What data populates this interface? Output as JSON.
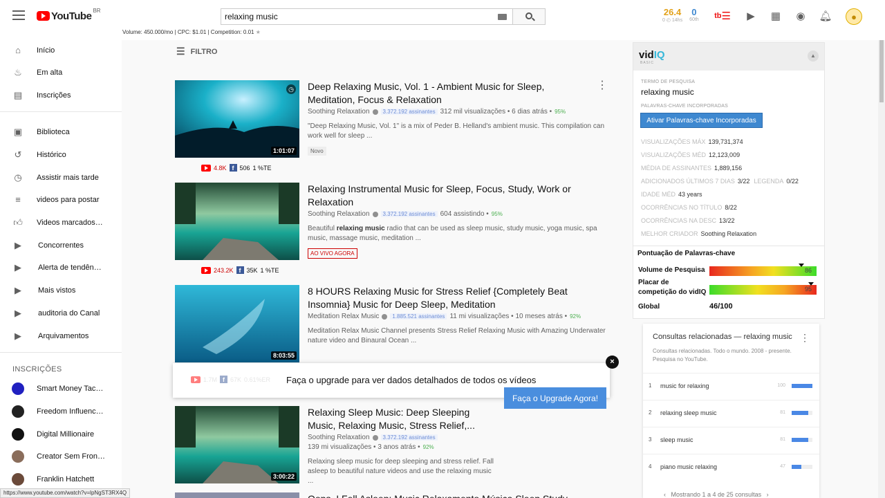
{
  "header": {
    "logo_text": "YouTube",
    "logo_region": "BR",
    "search_value": "relaxing music",
    "keyword_stats": "Volume: 450.000/mo | CPC: $1.01 | Competition: 0.01",
    "score1": {
      "value": "26.4",
      "sub": "0 ◴ 14hs"
    },
    "score2": {
      "value": "0",
      "sub": "60th"
    }
  },
  "sidebar": {
    "main": [
      {
        "label": "Início",
        "icon": "home-icon"
      },
      {
        "label": "Em alta",
        "icon": "fire-icon"
      },
      {
        "label": "Inscrições",
        "icon": "subscriptions-icon"
      }
    ],
    "library": [
      {
        "label": "Biblioteca",
        "icon": "folder-icon"
      },
      {
        "label": "Histórico",
        "icon": "history-icon"
      },
      {
        "label": "Assistir mais tarde",
        "icon": "clock-icon"
      },
      {
        "label": "videos para postar",
        "icon": "playlist-icon"
      },
      {
        "label": "Videos marcados…",
        "icon": "thumb-up-icon"
      },
      {
        "label": "Concorrentes",
        "icon": "playlist-play-icon"
      },
      {
        "label": "Alerta de tendên…",
        "icon": "playlist-play-icon"
      },
      {
        "label": "Mais vistos",
        "icon": "playlist-play-icon"
      },
      {
        "label": "auditoria do Canal",
        "icon": "playlist-play-icon"
      },
      {
        "label": "Arquivamentos",
        "icon": "playlist-play-icon"
      }
    ],
    "subs_header": "INSCRIÇÕES",
    "subscriptions": [
      {
        "label": "Smart Money Tac…",
        "color": "#2020c0"
      },
      {
        "label": "Freedom Influenc…",
        "color": "#222222"
      },
      {
        "label": "Digital Millionaire",
        "color": "#111111"
      },
      {
        "label": "Creator Sem Fron…",
        "color": "#8a6d5b"
      },
      {
        "label": "Franklin Hatchett",
        "color": "#6b4a3a"
      }
    ]
  },
  "status_url": "https://www.youtube.com/watch?v=lpNgST3RX4Q",
  "filter_label": "FILTRO",
  "videos": [
    {
      "title": "Deep Relaxing Music, Vol. 1 - Ambient Music for Sleep, Meditation, Focus & Relaxation",
      "channel": "Soothing Relaxation",
      "subs": "3.372.192 assinantes",
      "meta": "312 mil visualizações • 6 dias atrás •",
      "pct": "95%",
      "desc": "\"Deep Relaxing Music, Vol. 1\" is a mix of Peder B. Helland's ambient music. This compilation can work well for sleep ...",
      "badge": "Novo",
      "duration": "1:01:07",
      "yt": "4.8K",
      "fb": "506",
      "te": "1 %TE"
    },
    {
      "title": "Relaxing Instrumental Music for Sleep, Focus, Study, Work or Relaxation",
      "channel": "Soothing Relaxation",
      "subs": "3.372.192 assinantes",
      "meta": "604 assistindo •",
      "pct": "95%",
      "desc_pre": "Beautiful ",
      "desc_bold": "relaxing music",
      "desc_post": " radio that can be used as sleep music, study music, yoga music, spa music, massage music, meditation ...",
      "badge": "AO VIVO AGORA",
      "yt": "243.2K",
      "fb": "35K",
      "te": "1 %TE"
    },
    {
      "title": "8 HOURS Relaxing Music for Stress Relief {Completely Beat Insomnia} Music for Deep Sleep, Meditation",
      "channel": "Meditation Relax Music",
      "subs": "1.885.521 assinantes",
      "meta": "11 mi visualizações • 10 meses atrás •",
      "pct": "92%",
      "desc": "Meditation Relax Music Channel presents Stress Relief Relaxing Music with Amazing Underwater nature video and Binaural Ocean ...",
      "duration": "8:03:55"
    },
    {
      "title": "Relaxing Sleep Music: Deep Sleeping Music, Relaxing Music, Stress Relief,...",
      "channel": "Soothing Relaxation",
      "subs": "3.372.192 assinantes",
      "meta": "139 mi visualizações • 3 anos atrás •",
      "pct": "92%",
      "desc": "Relaxing sleep music for deep sleeping and stress relief. Fall asleep to beautiful nature videos and use the relaxing music ...",
      "duration": "3:00:22"
    },
    {
      "title": "Oops, I Fell Asleep: Music Relaxamento Música Sleep Study Meditative"
    }
  ],
  "upgrade": {
    "faded_yt": "1.7M",
    "faded_fb": "67K",
    "faded_er": "0.61%ER",
    "message": "Faça o upgrade para ver dados detalhados de todos os vídeos",
    "button": "Faça o Upgrade Agora!",
    "close": "×"
  },
  "vidiq": {
    "logo_a": "vid",
    "logo_b": "IQ",
    "logo_sub": "BASIC",
    "term_label": "TERMO DE PESQUISA",
    "term": "relaxing music",
    "embedded_label": "PALAVRAS-CHAVE INCORPORADAS",
    "embedded_button": "Ativar Palavras-chave Incorporadas",
    "rows": [
      {
        "label": "VISUALIZAÇÕES MÁX",
        "value": "139,731,374"
      },
      {
        "label": "VISUALIZAÇÕES MÉD",
        "value": "12,123,009"
      },
      {
        "label": "MÉDIA DE ASSINANTES",
        "value": "1,889,156"
      },
      {
        "label": "ADICIONADOS ÚLTIMOS 7 DIAS",
        "value": "3/22",
        "extra_label": "LEGENDA",
        "extra_value": "0/22"
      },
      {
        "label": "IDADE MÉD",
        "value": "43 years"
      },
      {
        "label": "OCORRÊNCIAS NO TÍTULO",
        "value": "8/22"
      },
      {
        "label": "OCORRÊNCIAS NA DESC",
        "value": "13/22"
      },
      {
        "label": "MELHOR CRIADOR",
        "value": "Soothing Relaxation"
      }
    ],
    "score_title": "Pontuação de Palavras-chave",
    "volume_label": "Volume de Pesquisa",
    "volume_value": "86",
    "competition_label": "Placar de competição do vidIQ",
    "competition_value": "95",
    "global_label": "Global",
    "global_value": "46/100"
  },
  "related": {
    "title": "Consultas relacionadas — relaxing music",
    "subtitle": "Consultas relacionadas. Todo o mundo. 2008 - presente. Pesquisa no YouTube.",
    "items": [
      {
        "rank": "1",
        "query": "music for relaxing",
        "value": "100",
        "fill": 1.0
      },
      {
        "rank": "2",
        "query": "relaxing sleep music",
        "value": "81",
        "fill": 0.81
      },
      {
        "rank": "3",
        "query": "sleep music",
        "value": "81",
        "fill": 0.81
      },
      {
        "rank": "4",
        "query": "piano music relaxing",
        "value": "47",
        "fill": 0.47
      }
    ],
    "footer": "Mostrando 1 a 4 de 25 consultas"
  }
}
